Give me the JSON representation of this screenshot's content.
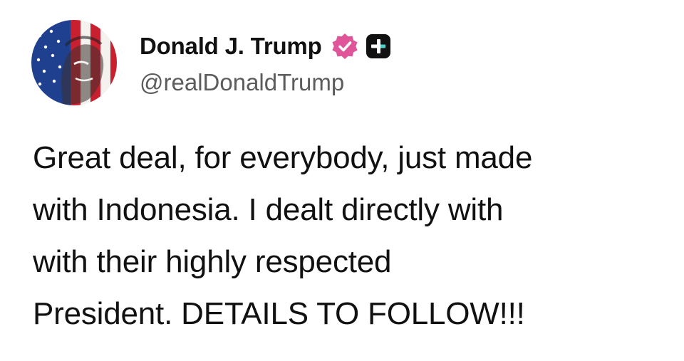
{
  "post": {
    "author": {
      "display_name": "Donald J. Trump",
      "handle": "@realDonaldTrump",
      "avatar_icon": "profile-avatar-flag-portrait",
      "verified_icon": "verified-badge-icon",
      "plus_icon": "plus-badge-icon"
    },
    "text_lines": [
      "Great deal, for everybody, just made",
      "with Indonesia. I dealt directly with",
      "with their highly respected",
      "President. DETAILS TO FOLLOW!!!"
    ]
  },
  "colors": {
    "verified_badge": "#e0549a",
    "plus_badge_bg": "#111111",
    "plus_badge_accent": "#4fd1c5",
    "handle_text": "#5c5c5c",
    "flag_red": "#c8202f",
    "flag_blue": "#1f3f8f"
  }
}
